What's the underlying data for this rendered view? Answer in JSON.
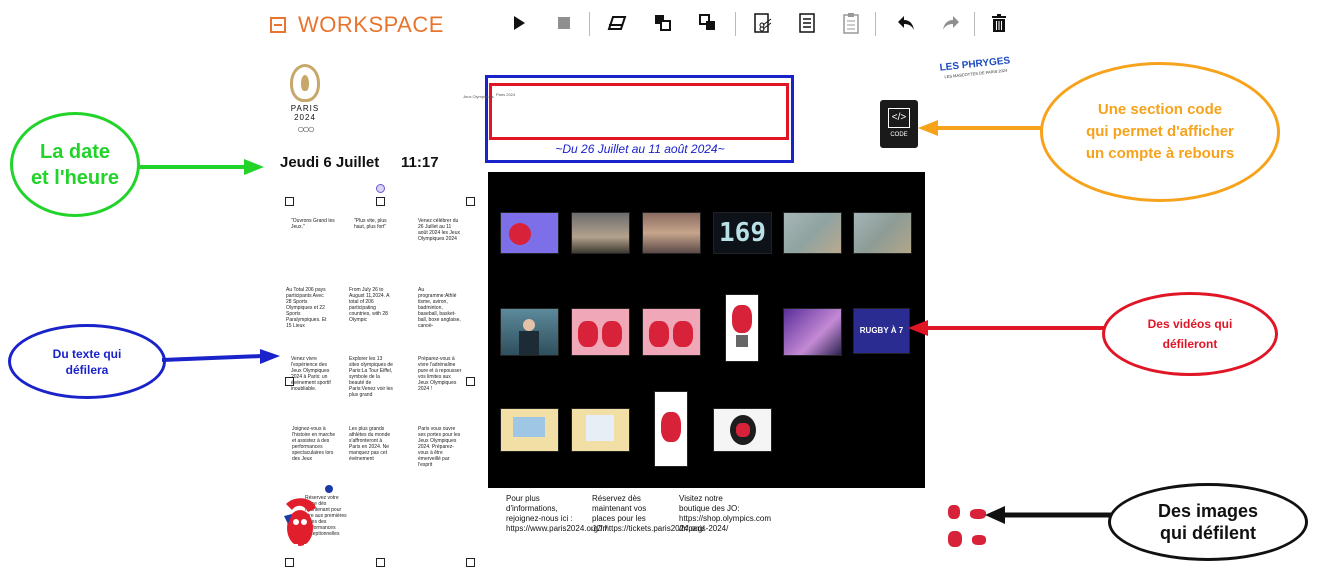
{
  "toolbar": {
    "title": "WORKSPACE",
    "icons": [
      "play-icon",
      "stop-icon",
      "eraser-icon",
      "bring-front-icon",
      "send-back-icon",
      "cut-icon",
      "copy-icon",
      "paste-icon",
      "undo-icon",
      "redo-icon",
      "trash-icon"
    ]
  },
  "canvas": {
    "logo_text": "PARIS 2024",
    "date": "Jeudi 6 Juillet",
    "time": "11:17",
    "countdown_range": "~Du 26 Juillet au 11 août 2024~",
    "countdown_mini_a": "Jeux Olympiques",
    "countdown_mini_b": "Paris 2024",
    "code_label": "CODE",
    "partner_logo": "LES PHRYGES",
    "partner_sub": "LES MASCOTTES DE PARIS 2024",
    "text_cells": [
      [
        "\"Ouvrons Grand les Jeux.\"",
        "\"Plus vite, plus haut, plus fort\"",
        "Venez célébrer du 26 Juillet au 11 août 2024 les Jeux Olympiques 2024"
      ],
      [
        "Au Total 206 pays participants Avec 28 Sports Olympiques et 22 Sports Paralympiques. Et 15 Lieux",
        "From July 26 to August 11,2024. A total of 206 participating countries, with 28 Olympic",
        "Au programme:Athlé tisme, aviron, badminton, baseball, basket-ball, boxe anglaise, canoë-"
      ],
      [
        "Venez vivre l'expérience des Jeux Olympiques 2024 à Paris: un événement sportif inoubliable.",
        "Explorer les 13 sites olympiques de Paris:La Tour Eiffel, symbole de la beauté de Paris:Venez voir les plus grand",
        "Préparez-vous à vivre l'adrénaline pure et à repousser vos limites aux Jeux Olympiques 2024 !"
      ],
      [
        "Joignez-vous à l'histoire en marche et assistez à des performances spectaculaires lors des Jeux",
        "Les plus grands athlètes du monde s'affronteront à Paris en 2024. Ne manquez pas cet événement",
        "Paris vous ouvre ses portes pour les Jeux Olympiques 2024. Préparez-vous à être émerveillé par l'esprit"
      ],
      [
        "Réservez votre place dès maintenant pour être aux premières loges des performances exceptionnelles"
      ]
    ],
    "footer": [
      "Pour plus d'informations, rejoignez-nous ici : https://www.paris2024.org/fr/",
      "Réservez dès maintenant vos places pour les JO:https://tickets.paris2024.org/",
      "Visitez notre boutique des JO: https://shop.olympics.com /fr/paris-2024/"
    ],
    "thumb_1_4_text": "169",
    "thumb_2_6_text": "RUGBY À 7"
  },
  "annotations": {
    "date_time": "La date et l'heure",
    "code": "Une section code qui permet d'afficher un compte à rebours",
    "text": "Du texte qui défilera",
    "videos": "Des vidéos qui défileront",
    "images": "Des images qui défilent"
  },
  "colors": {
    "accent": "#e8742e",
    "green": "#22d42a",
    "orange": "#f7a21b",
    "blue": "#1a22c9",
    "red": "#e01525",
    "black": "#111111"
  }
}
